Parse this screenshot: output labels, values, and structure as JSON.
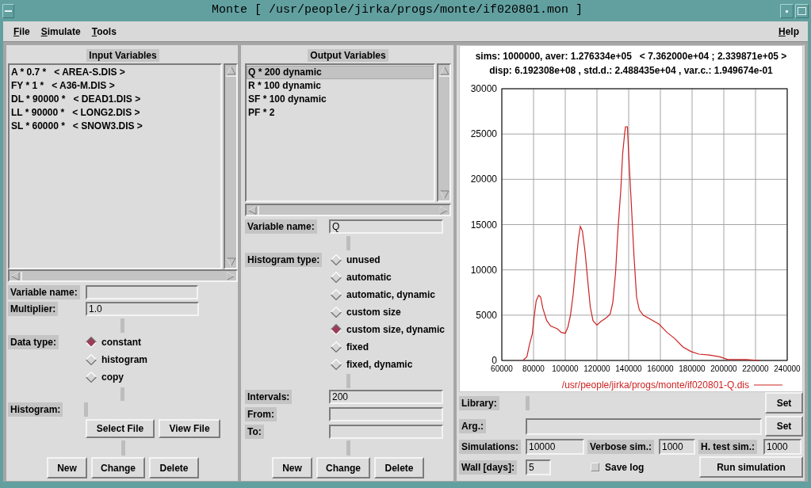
{
  "window": {
    "title": "Monte [ /usr/people/jirka/progs/monte/if020801.mon ]"
  },
  "menu": {
    "left": [
      "File",
      "Simulate",
      "Tools"
    ],
    "right": [
      "Help"
    ]
  },
  "input_panel": {
    "title": "Input Variables",
    "items": [
      {
        "label": "A * 0.7 *   < AREA-S.DIS >",
        "selected": false
      },
      {
        "label": "FY * 1 *   < A36-M.DIS >",
        "selected": false
      },
      {
        "label": "DL * 90000 *   < DEAD1.DIS >",
        "selected": false
      },
      {
        "label": "LL * 90000 *   < LONG2.DIS >",
        "selected": false
      },
      {
        "label": "SL * 60000 *   < SNOW3.DIS >",
        "selected": false
      }
    ],
    "variable_name": {
      "label": "Variable name:"
    },
    "multiplier": {
      "label": "Multiplier:",
      "value": "1.0"
    },
    "data_type": {
      "label": "Data type:",
      "options": [
        {
          "label": "constant",
          "selected": true
        },
        {
          "label": "histogram",
          "selected": false
        },
        {
          "label": "copy",
          "selected": false
        }
      ]
    },
    "histogram": {
      "label": "Histogram:"
    },
    "file_buttons": [
      "Select File",
      "View File"
    ],
    "buttons": [
      "New",
      "Change",
      "Delete"
    ]
  },
  "output_panel": {
    "title": "Output Variables",
    "items": [
      {
        "label": "Q * 200 dynamic",
        "selected": true
      },
      {
        "label": "R * 100 dynamic",
        "selected": false
      },
      {
        "label": "SF * 100 dynamic",
        "selected": false
      },
      {
        "label": "PF * 2",
        "selected": false
      }
    ],
    "variable_name": {
      "label": "Variable name:",
      "value": "Q"
    },
    "histogram_type": {
      "label": "Histogram type:",
      "options": [
        {
          "label": "unused",
          "selected": false
        },
        {
          "label": "automatic",
          "selected": false
        },
        {
          "label": "automatic, dynamic",
          "selected": false
        },
        {
          "label": "custom size",
          "selected": false
        },
        {
          "label": "custom size, dynamic",
          "selected": true
        },
        {
          "label": "fixed",
          "selected": false
        },
        {
          "label": "fixed, dynamic",
          "selected": false
        }
      ]
    },
    "intervals": {
      "label": "Intervals:",
      "value": "200"
    },
    "from": {
      "label": "From:"
    },
    "to": {
      "label": "To:"
    },
    "buttons": [
      "New",
      "Change",
      "Delete"
    ]
  },
  "results": {
    "summary": [
      "sims: 1000000, aver: 1.276334e+05   < 7.362000e+04 ; 2.339871e+05 >",
      "disp: 6.192308e+08 , std.d.: 2.488435e+04 , var.c.: 1.949674e-01"
    ],
    "chart_data": {
      "type": "line",
      "x": [
        73300,
        75800,
        77500,
        79200,
        80300,
        81700,
        83300,
        84500,
        85800,
        88300,
        90800,
        95000,
        97500,
        100000,
        101700,
        103300,
        105000,
        106700,
        108300,
        109500,
        110800,
        112500,
        114200,
        115800,
        117500,
        120000,
        122500,
        125800,
        128300,
        130000,
        131700,
        133300,
        135000,
        136200,
        137500,
        138000,
        139200,
        140000,
        141700,
        143300,
        145000,
        146700,
        149200,
        154200,
        159200,
        164200,
        169200,
        174200,
        179200,
        184200,
        190800,
        197500,
        202500,
        214200,
        222500
      ],
      "series": [
        {
          "name": "/usr/people/jirka/progs/monte/if020801-Q.dis",
          "color": "#cc2222",
          "values": [
            0,
            400,
            1800,
            2900,
            4700,
            6600,
            7200,
            7000,
            5800,
            4400,
            3800,
            3500,
            3100,
            3000,
            3700,
            5000,
            7300,
            10500,
            13400,
            14800,
            14300,
            12000,
            8800,
            5900,
            4400,
            3900,
            4300,
            4700,
            5100,
            6400,
            9600,
            14600,
            18700,
            22800,
            25100,
            25800,
            25800,
            22800,
            17200,
            11700,
            7000,
            5600,
            5000,
            4500,
            4000,
            3100,
            2400,
            1500,
            1000,
            700,
            600,
            400,
            100,
            100,
            0
          ]
        }
      ],
      "xlim": [
        60000,
        240000
      ],
      "ylim": [
        0,
        30000
      ],
      "xticks": [
        60000,
        80000,
        100000,
        120000,
        140000,
        160000,
        180000,
        200000,
        220000,
        240000
      ],
      "yticks": [
        0,
        5000,
        10000,
        15000,
        20000,
        25000,
        30000
      ],
      "grid": true
    },
    "library": {
      "label": "Library:",
      "button": "Set"
    },
    "arg": {
      "label": "Arg.:",
      "button": "Set"
    },
    "simulations": {
      "label": "Simulations:",
      "value": "10000"
    },
    "verbose_sim": {
      "label": "Verbose sim.:",
      "value": "1000"
    },
    "h_test_sim": {
      "label": "H. test sim.:",
      "value": "1000"
    },
    "wall": {
      "label": "Wall [days]:",
      "value": "5"
    },
    "save_log": {
      "label": "Save log",
      "checked": false
    },
    "run_button": "Run simulation"
  }
}
